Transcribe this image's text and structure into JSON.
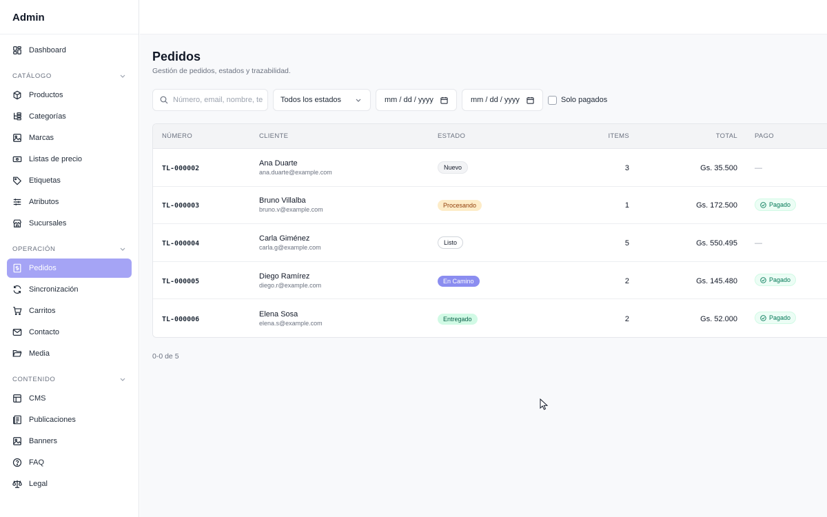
{
  "app": {
    "brand": "Admin"
  },
  "sidebar": {
    "dashboard": {
      "label": "Dashboard",
      "icon": "dashboard-icon"
    },
    "sections": [
      {
        "title": "CATÁLOGO",
        "items": [
          {
            "label": "Productos",
            "icon": "box-icon"
          },
          {
            "label": "Categorías",
            "icon": "category-tree-icon"
          },
          {
            "label": "Marcas",
            "icon": "image-icon"
          },
          {
            "label": "Listas de precio",
            "icon": "price-list-icon"
          },
          {
            "label": "Etiquetas",
            "icon": "tag-icon"
          },
          {
            "label": "Atributos",
            "icon": "sliders-icon"
          },
          {
            "label": "Sucursales",
            "icon": "store-icon"
          }
        ]
      },
      {
        "title": "OPERACIÓN",
        "items": [
          {
            "label": "Pedidos",
            "icon": "receipt-icon",
            "active": true
          },
          {
            "label": "Sincronización",
            "icon": "refresh-icon"
          },
          {
            "label": "Carritos",
            "icon": "cart-icon"
          },
          {
            "label": "Contacto",
            "icon": "mail-icon"
          },
          {
            "label": "Media",
            "icon": "folder-icon"
          }
        ]
      },
      {
        "title": "CONTENIDO",
        "items": [
          {
            "label": "CMS",
            "icon": "layout-icon"
          },
          {
            "label": "Publicaciones",
            "icon": "newspaper-icon"
          },
          {
            "label": "Banners",
            "icon": "image-icon"
          },
          {
            "label": "FAQ",
            "icon": "help-circle-icon"
          },
          {
            "label": "Legal",
            "icon": "scale-icon"
          }
        ]
      }
    ]
  },
  "page": {
    "title": "Pedidos",
    "subtitle": "Gestión de pedidos, estados y trazabilidad."
  },
  "filters": {
    "search_placeholder": "Número, email, nombre, te",
    "status_select": "Todos los estados",
    "date_from": "mm / dd / yyyy",
    "date_to": "mm / dd / yyyy",
    "paid_only_label": "Solo pagados",
    "paid_only_checked": false
  },
  "table": {
    "headers": {
      "number": "NÚMERO",
      "client": "CLIENTE",
      "status": "ESTADO",
      "items": "ITEMS",
      "total": "TOTAL",
      "payment": "PAGO"
    },
    "rows": [
      {
        "number": "TL-000002",
        "name": "Ana Duarte",
        "email": "ana.duarte@example.com",
        "status": "Nuevo",
        "status_kind": "nuevo",
        "items": "3",
        "total": "Gs. 35.500",
        "payment": "—",
        "paid": false
      },
      {
        "number": "TL-000003",
        "name": "Bruno Villalba",
        "email": "bruno.v@example.com",
        "status": "Procesando",
        "status_kind": "proc",
        "items": "1",
        "total": "Gs. 172.500",
        "payment": "Pagado",
        "paid": true
      },
      {
        "number": "TL-000004",
        "name": "Carla Giménez",
        "email": "carla.g@example.com",
        "status": "Listo",
        "status_kind": "listo",
        "items": "5",
        "total": "Gs. 550.495",
        "payment": "—",
        "paid": false
      },
      {
        "number": "TL-000005",
        "name": "Diego Ramírez",
        "email": "diego.r@example.com",
        "status": "En Camino",
        "status_kind": "camino",
        "items": "2",
        "total": "Gs. 145.480",
        "payment": "Pagado",
        "paid": true
      },
      {
        "number": "TL-000006",
        "name": "Elena Sosa",
        "email": "elena.s@example.com",
        "status": "Entregado",
        "status_kind": "entreg",
        "items": "2",
        "total": "Gs. 52.000",
        "payment": "Pagado",
        "paid": true
      }
    ]
  },
  "pagination": {
    "summary": "0-0 de 5"
  },
  "colors": {
    "accent": "#a5a4f5",
    "badge_en_camino": "#8b8df0",
    "paid_green": "#047857"
  }
}
